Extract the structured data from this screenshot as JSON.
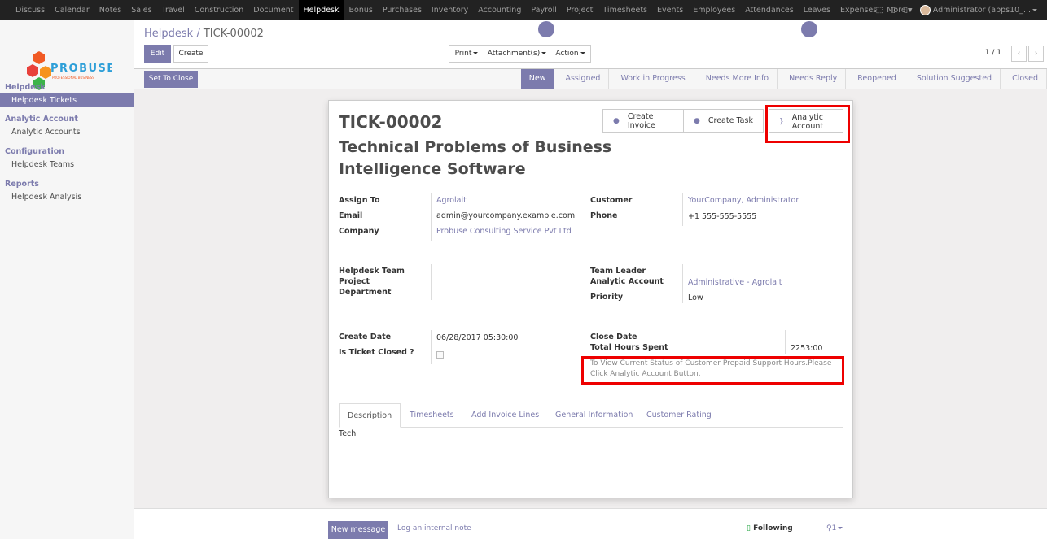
{
  "topmenu": [
    "Discuss",
    "Calendar",
    "Notes",
    "Sales",
    "Travel",
    "Construction",
    "Document",
    "Helpdesk",
    "Bonus",
    "Purchases",
    "Inventory",
    "Accounting",
    "Payroll",
    "Project",
    "Timesheets",
    "Events",
    "Employees",
    "Attendances",
    "Leaves",
    "Expenses",
    "More"
  ],
  "topmenu_active": "Helpdesk",
  "user": {
    "name": "Administrator (apps10_..."
  },
  "logo": {
    "text": "PROBUSE",
    "tagline": "PROFESSIONAL BUSINESS"
  },
  "sidebar": {
    "sections": [
      {
        "title": "Helpdesk",
        "items": [
          "Helpdesk Tickets"
        ]
      },
      {
        "title": "Analytic Account",
        "items": [
          "Analytic Accounts"
        ]
      },
      {
        "title": "Configuration",
        "items": [
          "Helpdesk Teams"
        ]
      },
      {
        "title": "Reports",
        "items": [
          "Helpdesk Analysis"
        ]
      }
    ],
    "active_item": "Helpdesk Tickets"
  },
  "breadcrumb": {
    "parent": "Helpdesk /",
    "current": "TICK-00002"
  },
  "buttons": {
    "edit": "Edit",
    "create": "Create",
    "print": "Print",
    "attachments": "Attachment(s)",
    "action": "Action",
    "set_to_close": "Set To Close"
  },
  "pager": {
    "text": "1 / 1"
  },
  "stages": [
    "New",
    "Assigned",
    "Work in Progress",
    "Needs More Info",
    "Needs Reply",
    "Reopened",
    "Solution Suggested",
    "Closed"
  ],
  "current_stage": "New",
  "smart_buttons": {
    "create_invoice": "Create Invoice",
    "create_task": "Create Task",
    "analytic_line1": "Analytic",
    "analytic_line2": "Account"
  },
  "record": {
    "number": "TICK-00002",
    "subject_line1": "Technical Problems of Business",
    "subject_line2": "Intelligence Software"
  },
  "fields": {
    "assign_to": {
      "label": "Assign To",
      "value": "Agrolait"
    },
    "email": {
      "label": "Email",
      "value": "admin@yourcompany.example.com"
    },
    "company": {
      "label": "Company",
      "value": "Probuse Consulting Service Pvt Ltd"
    },
    "customer": {
      "label": "Customer",
      "value": "YourCompany, Administrator"
    },
    "phone": {
      "label": "Phone",
      "value": "+1 555-555-5555"
    },
    "helpdesk_team": {
      "label": "Helpdesk Team",
      "value": ""
    },
    "project": {
      "label": "Project",
      "value": ""
    },
    "department": {
      "label": "Department",
      "value": ""
    },
    "team_leader": {
      "label": "Team Leader",
      "value": ""
    },
    "analytic_account": {
      "label": "Analytic Account",
      "value": "Administrative - Agrolait"
    },
    "priority": {
      "label": "Priority",
      "value": "Low"
    },
    "create_date": {
      "label": "Create Date",
      "value": "06/28/2017 05:30:00"
    },
    "is_ticket_closed": {
      "label": "Is Ticket Closed ?",
      "value": false
    },
    "close_date": {
      "label": "Close Date",
      "value": ""
    },
    "total_hours": {
      "label": "Total Hours Spent",
      "value": "2253:00"
    }
  },
  "note": "To View Current Status of Customer Prepaid Support Hours.Please Click Analytic Account Button.",
  "tabs": [
    "Description",
    "Timesheets",
    "Add Invoice Lines",
    "General Information",
    "Customer Rating"
  ],
  "active_tab": "Description",
  "description": "Tech",
  "chatter": {
    "new_message": "New message",
    "log_note": "Log an internal note",
    "following": "Following",
    "followers": "1"
  },
  "colors": {
    "brand": "#7c7bad",
    "highlight": "#e00000",
    "topbar": "#222222"
  }
}
